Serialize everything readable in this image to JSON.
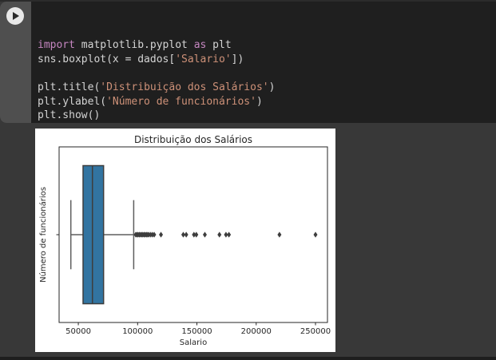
{
  "theme": {
    "page_bg": "#383838",
    "code_bg": "#1f1f1f",
    "gutter_bg": "#4f4f4f",
    "keyword_color": "#c586c0",
    "string_color": "#ce9178",
    "code_text_color": "#d4d4d4",
    "run_button_bg": "#e8e8e8",
    "figure_bg": "#ffffff"
  },
  "cell": {
    "run_button_label": "run-cell",
    "code_lines": [
      [
        {
          "t": "import",
          "c": "keyword"
        },
        {
          "t": " matplotlib.pyplot ",
          "c": "plain"
        },
        {
          "t": "as",
          "c": "keyword"
        },
        {
          "t": " plt",
          "c": "plain"
        }
      ],
      [
        {
          "t": "sns.boxplot(x = dados[",
          "c": "plain"
        },
        {
          "t": "'Salario'",
          "c": "string"
        },
        {
          "t": "])",
          "c": "plain"
        }
      ],
      [],
      [
        {
          "t": "plt.title(",
          "c": "plain"
        },
        {
          "t": "'Distribuição dos Salários'",
          "c": "string"
        },
        {
          "t": ")",
          "c": "plain"
        }
      ],
      [
        {
          "t": "plt.ylabel(",
          "c": "plain"
        },
        {
          "t": "'Número de funcionários'",
          "c": "string"
        },
        {
          "t": ")",
          "c": "plain"
        }
      ],
      [
        {
          "t": "plt.show()",
          "c": "plain"
        }
      ]
    ]
  },
  "chart_data": {
    "type": "boxplot",
    "orientation": "horizontal",
    "title": "Distribuição dos Salários",
    "xlabel": "Salario",
    "ylabel": "Número de funcionários",
    "xlim": [
      33800,
      260100
    ],
    "xticks": [
      50000,
      100000,
      150000,
      200000,
      250000
    ],
    "grid": false,
    "box": {
      "q1": 54000,
      "median": 61900,
      "q3": 71300,
      "whisker_low": 43700,
      "whisker_high": 96700
    },
    "outliers": [
      98400,
      99400,
      100400,
      101400,
      102400,
      103400,
      104400,
      105400,
      106400,
      107400,
      108400,
      109500,
      111000,
      112500,
      114000,
      119700,
      138500,
      141000,
      147500,
      149500,
      156700,
      169000,
      174500,
      177000,
      219600,
      250000
    ],
    "box_fill": "#3274a1",
    "box_edge": "#3d3d3d",
    "whisker_color": "#5e5e5e",
    "flier_color": "#3d3d3d",
    "spine_color": "#262626",
    "label_color": "#262626"
  }
}
